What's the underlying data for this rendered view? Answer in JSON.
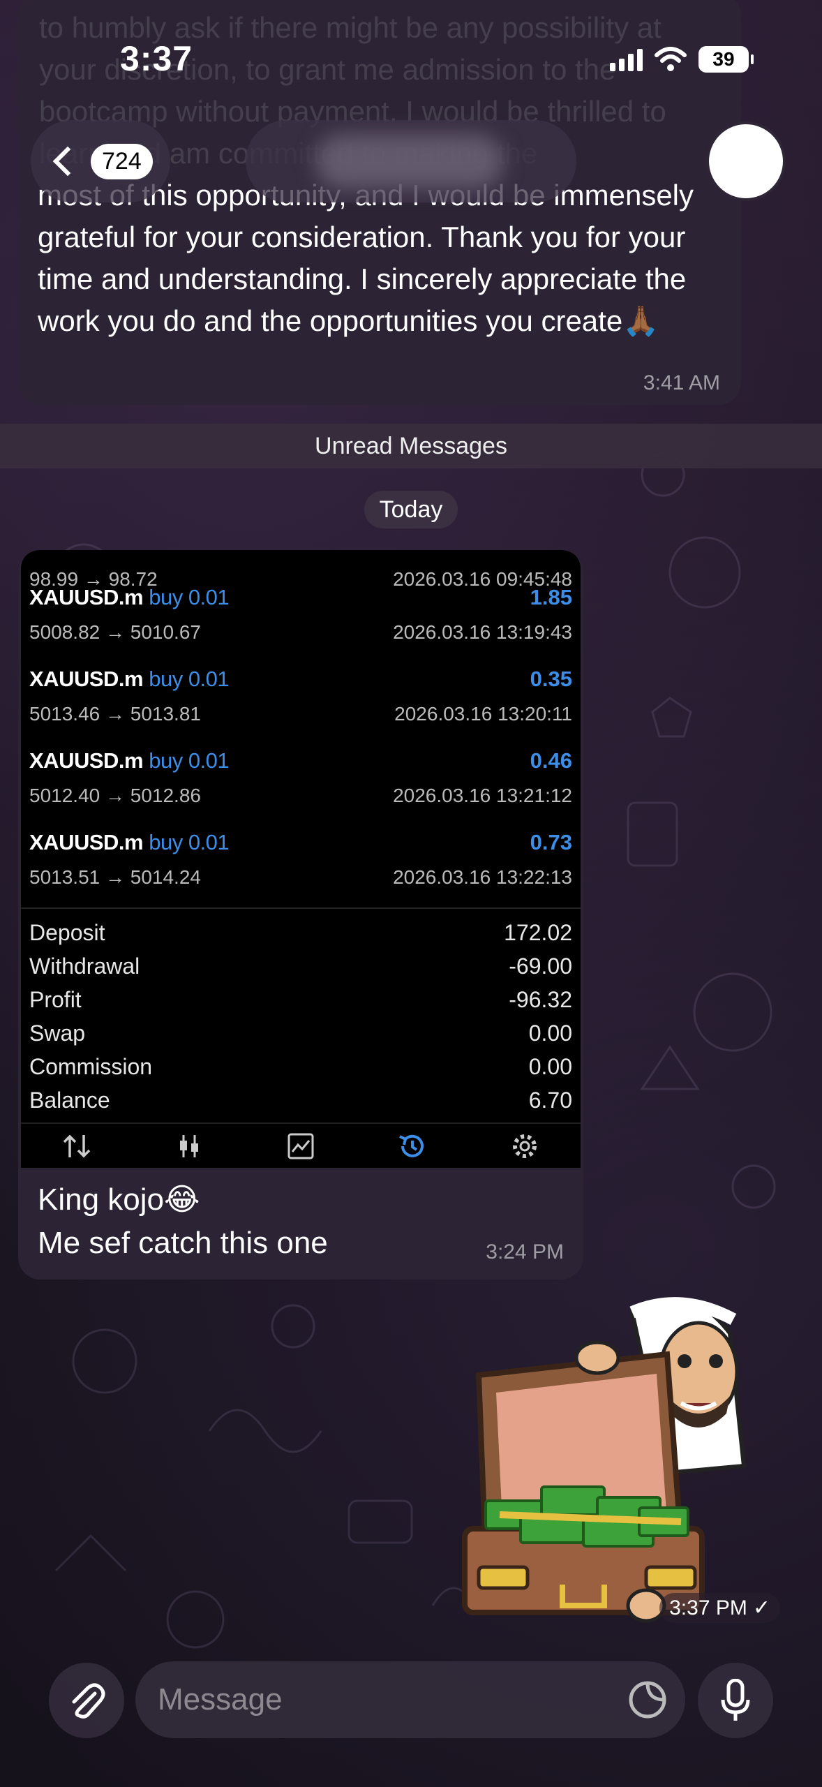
{
  "status_bar": {
    "time": "3:37",
    "battery": "39"
  },
  "header": {
    "back_count": "724"
  },
  "messages": {
    "msg1": {
      "faded_text": "to humbly ask if there might be any possibility at your discretion, to grant me admission to the bootcamp without payment. I would be thrilled to learn and am committed to making the",
      "text": "most of this opportunity, and I would be immensely grateful for your consideration. Thank you for your time and understanding. I sincerely appreciate the work you do and the opportunities you create🙏🏾",
      "time": "3:41 AM"
    },
    "unread_label": "Unread Messages",
    "date_label": "Today",
    "msg2": {
      "top_partial": {
        "price": "98.99 → 98.72",
        "time": "2026.03.16 09:45:48"
      },
      "trades": [
        {
          "symbol": "XAUUSD.m",
          "side": "buy 0.01",
          "pl": "1.85",
          "price": "5008.82 → 5010.67",
          "time": "2026.03.16 13:19:43"
        },
        {
          "symbol": "XAUUSD.m",
          "side": "buy 0.01",
          "pl": "0.35",
          "price": "5013.46 → 5013.81",
          "time": "2026.03.16 13:20:11"
        },
        {
          "symbol": "XAUUSD.m",
          "side": "buy 0.01",
          "pl": "0.46",
          "price": "5012.40 → 5012.86",
          "time": "2026.03.16 13:21:12"
        },
        {
          "symbol": "XAUUSD.m",
          "side": "buy 0.01",
          "pl": "0.73",
          "price": "5013.51 → 5014.24",
          "time": "2026.03.16 13:22:13"
        }
      ],
      "summary": [
        {
          "label": "Deposit",
          "value": "172.02"
        },
        {
          "label": "Withdrawal",
          "value": "-69.00"
        },
        {
          "label": "Profit",
          "value": "-96.32"
        },
        {
          "label": "Swap",
          "value": "0.00"
        },
        {
          "label": "Commission",
          "value": "0.00"
        },
        {
          "label": "Balance",
          "value": "6.70"
        }
      ],
      "caption_line1": "King kojo😂",
      "caption_line2": "Me sef catch this one",
      "time": "3:24 PM"
    },
    "sticker": {
      "time": "3:37 PM",
      "check": "✓"
    }
  },
  "input": {
    "placeholder": "Message"
  },
  "colors": {
    "accent": "#3d8ee8",
    "bubble_in": "#2c2434",
    "background": "#1a1520"
  }
}
